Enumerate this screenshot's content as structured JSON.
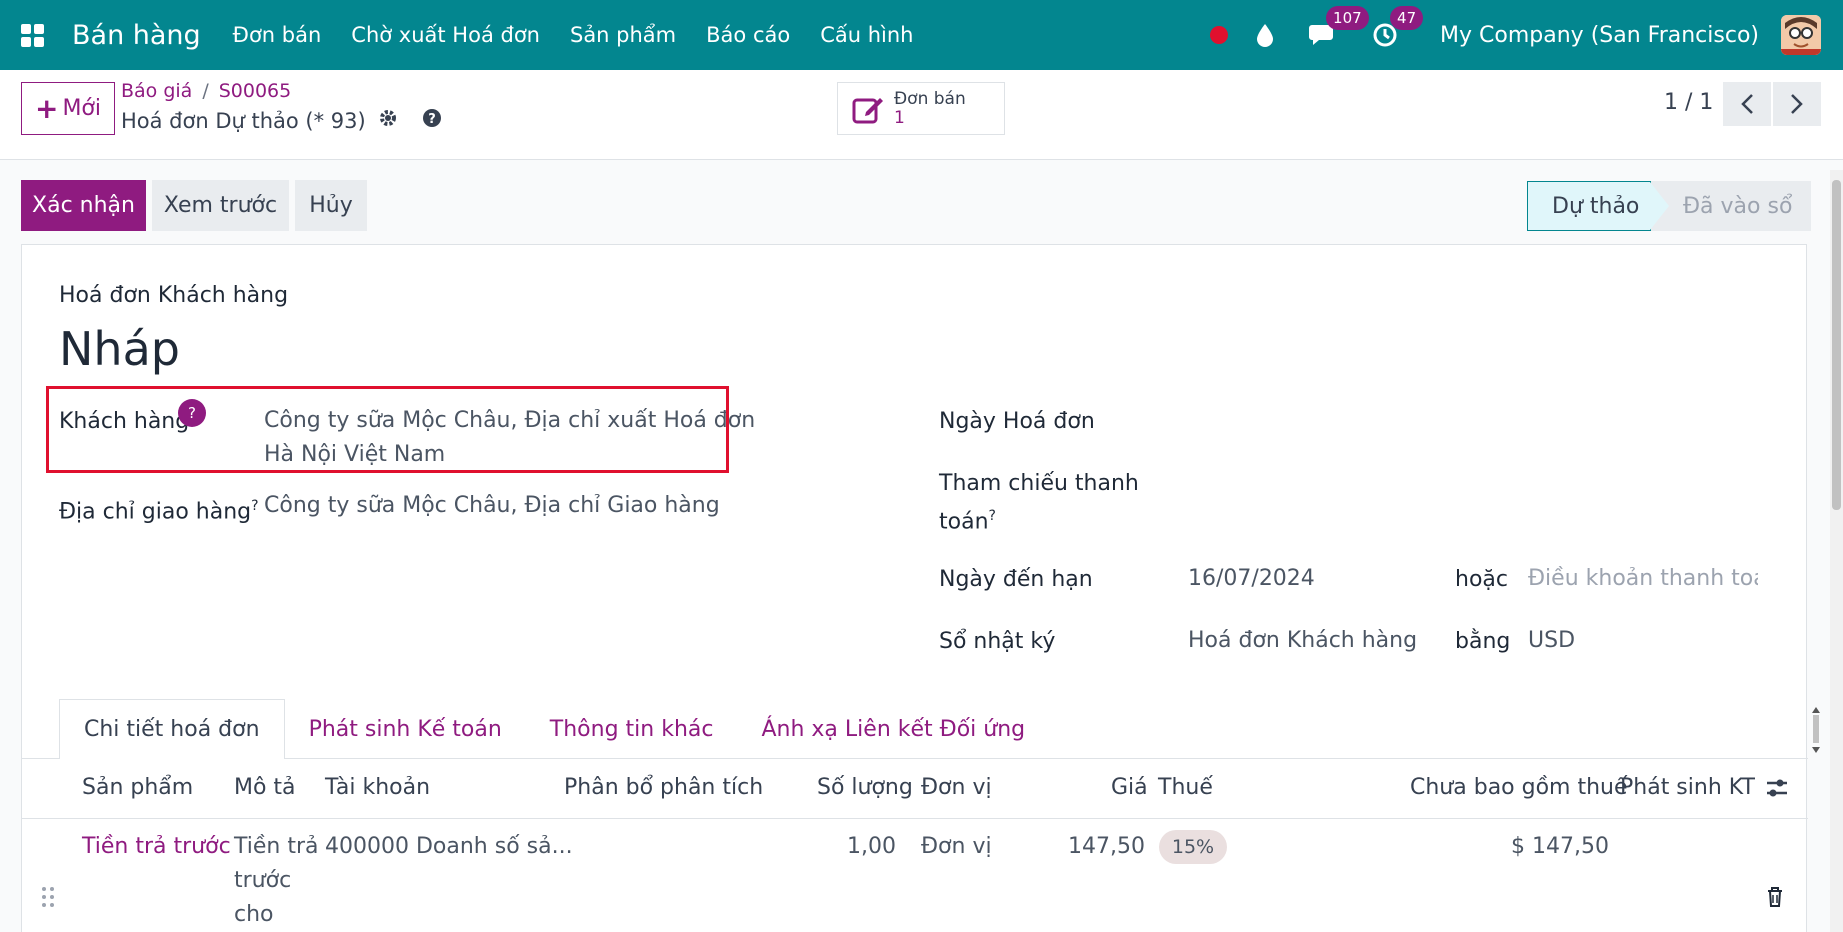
{
  "navbar": {
    "app_name": "Bán hàng",
    "menu": [
      "Đơn bán",
      "Chờ xuất Hoá đơn",
      "Sản phẩm",
      "Báo cáo",
      "Cấu hình"
    ],
    "messages_count": "107",
    "activities_count": "47",
    "company": "My Company (San Francisco)",
    "bg_color": "#03868f"
  },
  "control": {
    "new_label": "Mới",
    "breadcrumb": [
      "Báo giá",
      "S00065"
    ],
    "record_title": "Hoá đơn Dự thảo (* 93)",
    "smart_button": {
      "title": "Đơn bán",
      "value": "1"
    },
    "pager": "1 / 1"
  },
  "actions": {
    "confirm": "Xác nhận",
    "preview": "Xem trước",
    "cancel": "Hủy"
  },
  "status": {
    "current": "Dự thảo",
    "next": "Đã vào sổ"
  },
  "form": {
    "doc_type": "Hoá đơn Khách hàng",
    "doc_name": "Nháp",
    "customer_label": "Khách hàng",
    "customer_help": "?",
    "customer_line1": "Công ty sữa Mộc Châu, Địa chỉ xuất Hoá đơn",
    "customer_line2": "Hà Nội Việt Nam",
    "delivery_label": "Địa chỉ giao hàng",
    "delivery_value": "Công ty sữa Mộc Châu, Địa chỉ Giao hàng",
    "invoice_date_label": "Ngày Hoá đơn",
    "payment_ref_label_1": "Tham chiếu thanh",
    "payment_ref_label_2": "toán",
    "due_date_label": "Ngày đến hạn",
    "due_date_value": "16/07/2024",
    "or_label": "hoặc",
    "payment_terms_placeholder": "Điều khoản thanh toán",
    "journal_label": "Sổ nhật ký",
    "journal_value": "Hoá đơn Khách hàng",
    "currency_label": "bằng",
    "currency_value": "USD",
    "help_mark": "?"
  },
  "tabs": [
    "Chi tiết hoá đơn",
    "Phát sinh Kế toán",
    "Thông tin khác",
    "Ánh xạ Liên kết Đối ứng"
  ],
  "table": {
    "headers": [
      "Sản phẩm",
      "Mô tả",
      "Tài khoản",
      "Phân bổ phân tích",
      "Số lượng",
      "Đơn vị",
      "Giá",
      "Thuế",
      "Chưa bao gồm thuế",
      "Phát sinh KT"
    ],
    "row": {
      "product": "Tiền trả trước",
      "desc_lines": [
        "Tiền trả",
        "trước",
        "cho"
      ],
      "account": "400000 Doanh số sả...",
      "quantity": "1,00",
      "uom": "Đơn vị",
      "price": "147,50",
      "tax": "15%",
      "subtotal": "$ 147,50"
    }
  }
}
